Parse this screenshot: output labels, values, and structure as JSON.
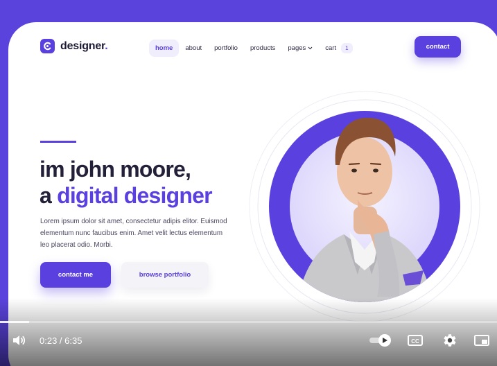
{
  "site": {
    "logo_text": "designer",
    "logo_dot": "."
  },
  "nav": {
    "items": [
      {
        "label": "home",
        "active": true
      },
      {
        "label": "about"
      },
      {
        "label": "portfolio"
      },
      {
        "label": "products"
      },
      {
        "label": "pages",
        "has_dropdown": true
      },
      {
        "label": "cart",
        "badge": "1"
      }
    ],
    "contact_label": "contact"
  },
  "hero": {
    "title_line1": "im john moore,",
    "title_line2_prefix": "a ",
    "title_line2_highlight": "digital designer",
    "description": "Lorem ipsum dolor sit amet, consectetur adipis elitor. Euismod elementum nunc faucibus enim. Amet velit lectus elementum leo placerat odio. Morbi.",
    "primary_button": "contact me",
    "secondary_button": "browse portfolio"
  },
  "video_player": {
    "current_time": "0:23",
    "duration": "6:35",
    "time_display": "0:23 / 6:35",
    "progress": 0.058,
    "icons": [
      "volume-icon",
      "autoplay-toggle-icon",
      "captions-icon",
      "settings-icon",
      "miniplayer-icon"
    ]
  },
  "colors": {
    "accent": "#5b40e0",
    "background": "#5a43dc",
    "text_dark": "#23213a"
  }
}
